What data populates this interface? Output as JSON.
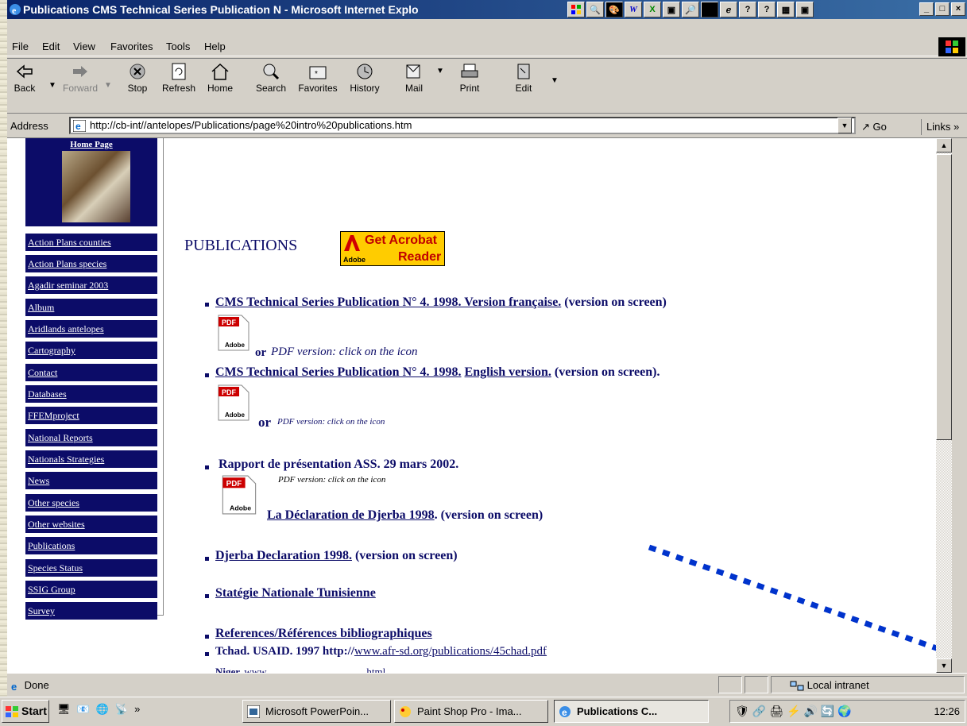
{
  "window": {
    "title": "Publications  CMS Technical Series Publication N - Microsoft Internet Explo",
    "controls": [
      "minimize",
      "maximize",
      "close"
    ]
  },
  "menu": [
    "File",
    "Edit",
    "View",
    "Favorites",
    "Tools",
    "Help"
  ],
  "toolbar": {
    "back": "Back",
    "forward": "Forward",
    "stop": "Stop",
    "refresh": "Refresh",
    "home": "Home",
    "search": "Search",
    "favorites": "Favorites",
    "history": "History",
    "mail": "Mail",
    "print": "Print",
    "edit": "Edit"
  },
  "address": {
    "label": "Address",
    "url": "http://cb-int//antelopes/Publications/page%20intro%20publications.htm",
    "go": "Go",
    "links": "Links »"
  },
  "nav": {
    "home": "Home Page",
    "items": [
      "Action Plans counties",
      "Action Plans species",
      "Agadir seminar 2003",
      "Album",
      "Aridlands antelopes",
      "Cartography",
      "Contact",
      "Databases",
      "FFEMproject",
      "National Reports",
      "Nationals Strategies",
      "News",
      "Other species",
      "Other websites",
      "Publications",
      "Species Status",
      "SSIG Group",
      "Survey"
    ]
  },
  "page": {
    "heading": "PUBLICATIONS",
    "acrobat": {
      "line1": "Get Acrobat",
      "line2": "Reader",
      "brand": "Adobe"
    },
    "pdf_label": "PDF",
    "adobe_label": "Adobe",
    "items": [
      {
        "link": "CMS Technical Series Publication N° 4. 1998. Version française.",
        "suffix": " (version on screen)"
      },
      {
        "or": "or",
        "pdf_text": "PDF version: click on the icon"
      },
      {
        "link_a": "CMS Technical Series Publication N° 4. 1998.",
        "link_b": "English version.",
        "suffix": " (version on screen)."
      },
      {
        "or": "or",
        "pdf_text": "PDF version: click on the icon"
      },
      {
        "text": "Rapport de présentation ASS. 29 mars 2002."
      },
      {
        "pdf_text": "PDF version: click on the icon"
      },
      {
        "link": "La Déclaration de Djerba 1998",
        "suffix": ". (version on screen)"
      },
      {
        "link": "Djerba Declaration 1998.",
        "suffix": " (version on screen)"
      },
      {
        "link": "Statégie Nationale Tunisienne"
      },
      {
        "link": "References/Références bibliographiques"
      },
      {
        "prefix": "Tchad. USAID. 1997 http://",
        "url": "www.afr-sd.org/publications/45chad.pdf"
      },
      {
        "prefix": "Niger.",
        "url": "www.......................................html"
      }
    ]
  },
  "status": {
    "text": "Done",
    "zone": "Local intranet"
  },
  "taskbar": {
    "start": "Start",
    "chevron": "»",
    "tasks": [
      "Microsoft PowerPoin...",
      "Paint Shop Pro - Ima...",
      "Publications  C..."
    ],
    "clock": "12:26"
  }
}
